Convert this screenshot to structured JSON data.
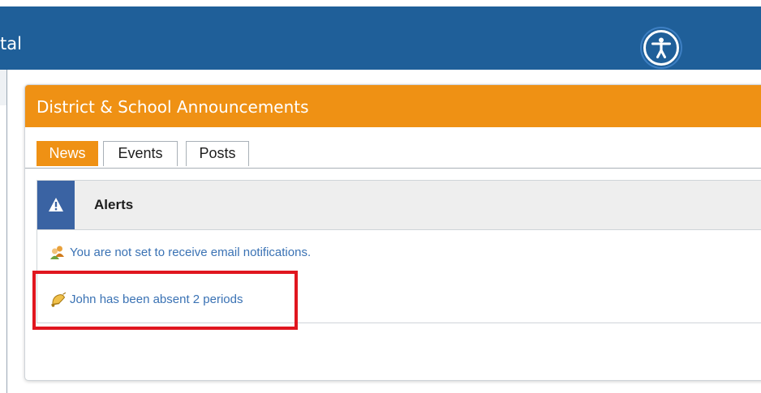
{
  "header": {
    "title_fragment": "tal",
    "accessibility_icon": "accessibility-icon"
  },
  "announcements": {
    "title": "District & School Announcements",
    "tabs": [
      {
        "label": "News",
        "active": true
      },
      {
        "label": "Events",
        "active": false
      },
      {
        "label": "Posts",
        "active": false
      }
    ],
    "alerts": {
      "title": "Alerts",
      "icon": "warning-icon",
      "items": [
        {
          "text": "You are not set to receive email notifications.",
          "icon": "users-icon"
        },
        {
          "text": "John has been absent 2 periods",
          "icon": "bell-icon"
        }
      ]
    }
  },
  "colors": {
    "header_blue": "#1f5f99",
    "orange": "#ef9114",
    "link_blue": "#3a72b4",
    "alert_icon_blue": "#3a63a3",
    "highlight_red": "#e0161f"
  }
}
